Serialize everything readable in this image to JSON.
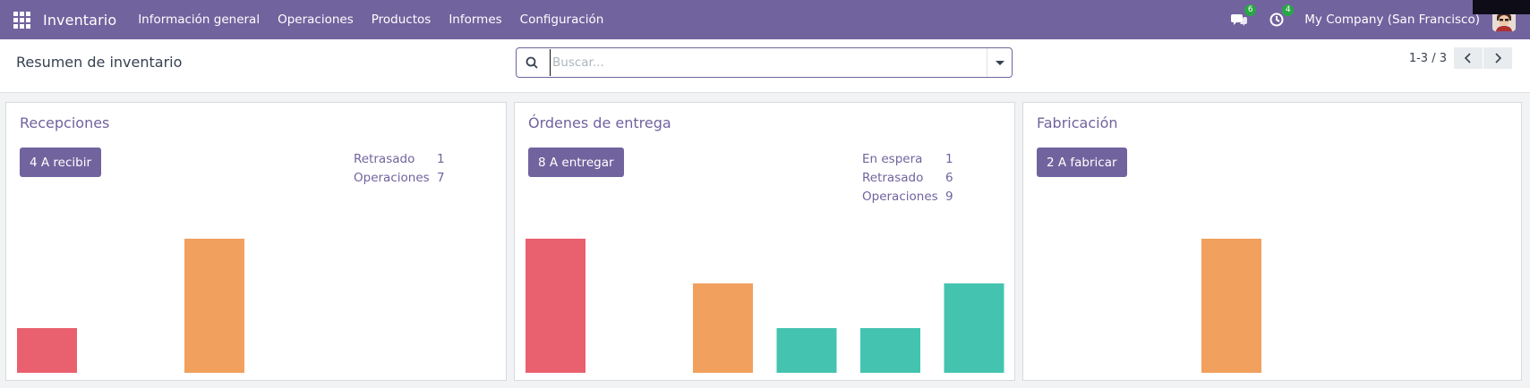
{
  "navbar": {
    "app_name": "Inventario",
    "menu": [
      "Información general",
      "Operaciones",
      "Productos",
      "Informes",
      "Configuración"
    ],
    "messages_count": "6",
    "activities_count": "4",
    "company": "My Company (San Francisco)",
    "accent": "#71639e"
  },
  "control_panel": {
    "title": "Resumen de inventario",
    "search_placeholder": "Buscar...",
    "pager": "1-3 / 3"
  },
  "cards": [
    {
      "title": "Recepciones",
      "button": "4 A recibir",
      "stats": [
        {
          "label": "Retrasado",
          "value": "1"
        },
        {
          "label": "Operaciones",
          "value": "7"
        }
      ],
      "bars": [
        {
          "value": 1,
          "color": "#e9606f"
        },
        {
          "value": 0,
          "color": "#f2a05e"
        },
        {
          "value": 3,
          "color": "#f2a05e"
        },
        {
          "value": 0,
          "color": "#44c4b0"
        },
        {
          "value": 0,
          "color": "#44c4b0"
        },
        {
          "value": 0,
          "color": "#44c4b0"
        }
      ]
    },
    {
      "title": "Órdenes de entrega",
      "button": "8 A entregar",
      "stats": [
        {
          "label": "En espera",
          "value": "1"
        },
        {
          "label": "Retrasado",
          "value": "6"
        },
        {
          "label": "Operaciones",
          "value": "9"
        }
      ],
      "bars": [
        {
          "value": 3,
          "color": "#e9606f"
        },
        {
          "value": 0,
          "color": "#f2a05e"
        },
        {
          "value": 2,
          "color": "#f2a05e"
        },
        {
          "value": 1,
          "color": "#44c4b0"
        },
        {
          "value": 1,
          "color": "#44c4b0"
        },
        {
          "value": 2,
          "color": "#44c4b0"
        }
      ]
    },
    {
      "title": "Fabricación",
      "button": "2 A fabricar",
      "stats": [],
      "bars": [
        {
          "value": 0,
          "color": "#e9606f"
        },
        {
          "value": 0,
          "color": "#f2a05e"
        },
        {
          "value": 3,
          "color": "#f2a05e"
        },
        {
          "value": 0,
          "color": "#44c4b0"
        },
        {
          "value": 0,
          "color": "#44c4b0"
        },
        {
          "value": 0,
          "color": "#44c4b0"
        }
      ]
    }
  ]
}
